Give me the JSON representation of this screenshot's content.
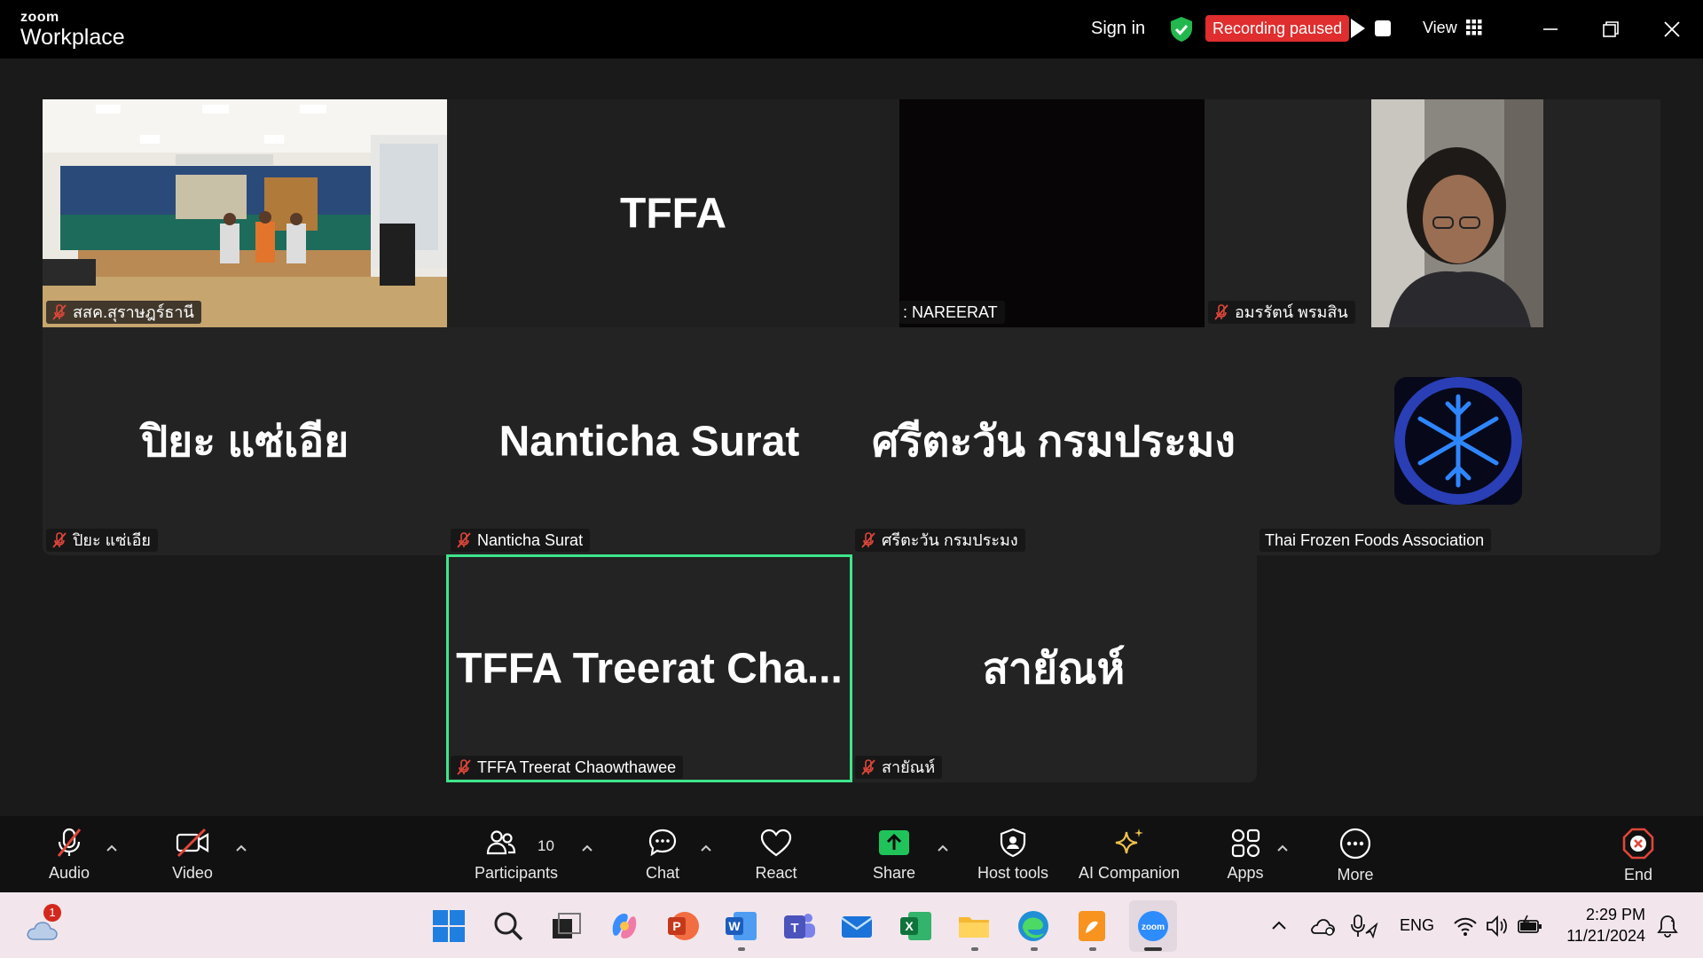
{
  "app": {
    "brand_small": "zoom",
    "brand_big": "Workplace"
  },
  "header": {
    "sign_in": "Sign in",
    "recording_status": "Recording paused",
    "view_label": "View"
  },
  "tiles": [
    {
      "name": "สสค.สุราษฎร์ธานี",
      "big": "",
      "muted": true,
      "type": "video-room"
    },
    {
      "name": "",
      "big": "TFFA",
      "muted": false,
      "type": "name"
    },
    {
      "name": ": NAREERAT",
      "big": "",
      "muted": false,
      "type": "video-dark"
    },
    {
      "name": "อมรรัตน์ พรมสิน",
      "big": "",
      "muted": true,
      "type": "video-person"
    },
    {
      "name": "ปิยะ แซ่เอีย",
      "big": "ปิยะ แซ่เอีย",
      "muted": true,
      "type": "name"
    },
    {
      "name": "Nanticha Surat",
      "big": "Nanticha Surat",
      "muted": true,
      "type": "name"
    },
    {
      "name": "ศรีตะวัน กรมประมง",
      "big": "ศรีตะวัน กรมประมง",
      "muted": true,
      "type": "name"
    },
    {
      "name": "Thai Frozen Foods Association",
      "big": "",
      "muted": false,
      "type": "logo"
    },
    {
      "name": "TFFA Treerat Chaowthawee",
      "big": "TFFA Treerat Cha...",
      "muted": true,
      "type": "name",
      "active": true
    },
    {
      "name": "สายัณห์",
      "big": "สายัณห์",
      "muted": true,
      "type": "name"
    }
  ],
  "toolbar": {
    "audio": "Audio",
    "video": "Video",
    "participants": "Participants",
    "participant_count": "10",
    "chat": "Chat",
    "react": "React",
    "share": "Share",
    "host_tools": "Host tools",
    "ai_companion": "AI Companion",
    "apps": "Apps",
    "more": "More",
    "end": "End"
  },
  "taskbar": {
    "weather_badge": "1",
    "language": "ENG",
    "time": "2:29 PM",
    "date": "11/21/2024"
  },
  "colors": {
    "recording": "#e02d2d",
    "active_speaker": "#3ee58c",
    "share": "#1fc35a",
    "muted_icon": "#e0463a",
    "end": "#e0463a"
  }
}
